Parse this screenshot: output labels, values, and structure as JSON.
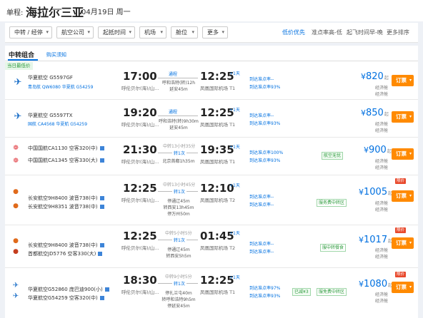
{
  "header": {
    "label": "单程:",
    "from": "海拉尔",
    "to": "三亚",
    "date": "04月19日 周一"
  },
  "filters": [
    {
      "label": "中转 / 经停"
    },
    {
      "label": "航空公司"
    },
    {
      "label": "起抵时间"
    },
    {
      "label": "机场"
    },
    {
      "label": "舱位"
    },
    {
      "label": "更多"
    }
  ],
  "sort": [
    {
      "label": "低价优先",
      "active": true
    },
    {
      "label": "准点率高-低",
      "active": false
    },
    {
      "label": "起飞时间早-晚",
      "active": false
    },
    {
      "label": "更多排序",
      "active": false
    }
  ],
  "tabs": {
    "active": "中转组合",
    "other": "购买须知"
  },
  "cheapest_tag": "当日最低价",
  "common": {
    "book": "订票",
    "caret": "▾",
    "yen": "¥",
    "qi": "起",
    "cabin1": "经济舱",
    "cabin2": "经济舱"
  },
  "flights": [
    {
      "airline": "华夏航空 G5597GF",
      "sub": "青岛航 QW6080  华夏航 G54259",
      "dep_time": "17:00",
      "dep_apt": "呼伦贝尔(海)/山...",
      "arr_time": "12:25",
      "plus": "+1天",
      "arr_apt": "凤凰国际机场 T1",
      "mid_top": "",
      "mid_blue": "通程",
      "notes": [
        "呼和浩特(转)12h",
        "延安45m"
      ],
      "ontime": [
        "到达准点率--",
        "到达准点率93%"
      ],
      "badge": "",
      "badge2": "",
      "price": "820",
      "discount": ""
    },
    {
      "airline": "华夏航空 G5597TX",
      "sub": "国航 CA4568  华夏航 G54259",
      "dep_time": "19:20",
      "dep_apt": "呼伦贝尔(海)/山...",
      "arr_time": "12:25",
      "plus": "+1天",
      "arr_apt": "凤凰国际机场 T1",
      "mid_top": "",
      "mid_blue": "通程",
      "notes": [
        "呼和浩特(转)9h30m",
        "延安45m"
      ],
      "ontime": [
        "到达准点率--",
        "到达准点率93%"
      ],
      "badge": "",
      "badge2": "",
      "price": "850",
      "discount": ""
    },
    {
      "airline": "中国国航CA1130 空客320(中)",
      "sub": "中国国航CA1345 空客330(大)",
      "dep_time": "21:30",
      "dep_apt": "呼伦贝尔(海)/山...",
      "arr_time": "19:35",
      "plus": "+1天",
      "arr_apt": "凤凰国际机场 T1",
      "mid_top": "中转13小时35分",
      "mid_blue": "转1次",
      "notes": [
        "北京首都1h35m"
      ],
      "ontime": [
        "到达准点率100%",
        "到达准点率93%"
      ],
      "badge": "航空无忧",
      "badge2": "",
      "price": "900",
      "discount": ""
    },
    {
      "airline": "长安航空9H8400 波音738(中)",
      "sub": "长安航空9H8351 波音738(中)",
      "dep_time": "12:25",
      "dep_apt": "呼伦贝尔(海)/山...",
      "arr_time": "12:10",
      "plus": "+1天",
      "arr_apt": "凤凰国际机场 T2",
      "mid_top": "中转13小时45分",
      "mid_blue": "转1次",
      "notes": [
        "停通辽45m",
        "转西安13h45m",
        "停万州50m"
      ],
      "ontime": [
        "到达准点率--",
        "到达准点率--"
      ],
      "badge": "",
      "badge2": "服务费中转区",
      "price": "1005",
      "discount": "限价"
    },
    {
      "airline": "长安航空9H8400 波音738(中)",
      "sub": "首都航空JD5776 空客330(大)",
      "dep_time": "12:25",
      "dep_apt": "呼伦贝尔(海)/山...",
      "arr_time": "01:45",
      "plus": "+1天",
      "arr_apt": "凤凰国际机场 T2",
      "mid_top": "中转5小时5分",
      "mid_blue": "转1次",
      "notes": [
        "停通辽45m",
        "转西安5h5m"
      ],
      "ontime": [
        "到达准点率--",
        "到达准点率--"
      ],
      "badge": "",
      "badge2": "服中转餐食",
      "price": "1017",
      "discount": "限价"
    },
    {
      "airline": "华夏航空G52860 庞巴迪900(小)",
      "sub": "华夏航空G54259 空客320(中)",
      "dep_time": "18:30",
      "dep_apt": "呼伦贝尔(海)/山...",
      "arr_time": "12:25",
      "plus": "+1天",
      "arr_apt": "凤凰国际机场 T1",
      "mid_top": "中转9小时5分",
      "mid_blue": "转1次",
      "notes": [
        "停扎兰屯40m",
        "转呼和浩特9h5m",
        "停延安45m"
      ],
      "ontime": [
        "到达准点率97%",
        "到达准点率93%"
      ],
      "badge": "已减¥3",
      "badge2": "服免费中转区",
      "price": "1080",
      "discount": "限价"
    }
  ]
}
